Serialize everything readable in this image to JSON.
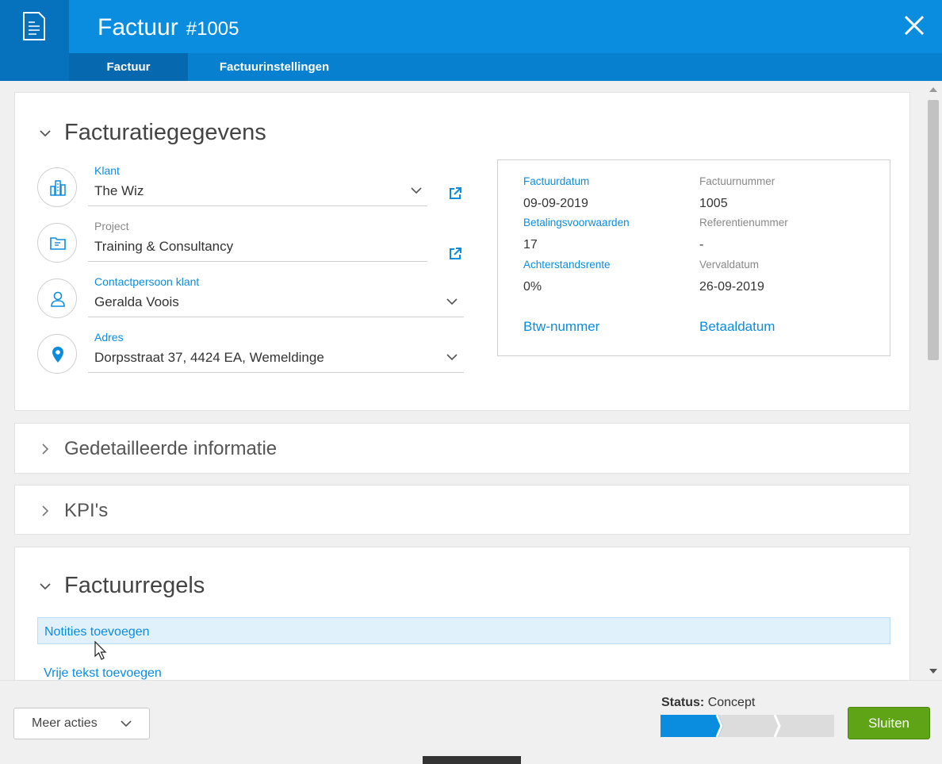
{
  "header": {
    "title": "Factuur",
    "number": "#1005",
    "tabs": [
      {
        "label": "Factuur",
        "active": true
      },
      {
        "label": "Factuurinstellingen",
        "active": false
      }
    ],
    "colors": {
      "header": "#0a8ddf",
      "tile": "#0672bd",
      "tab_active": "#0669b0"
    }
  },
  "facturatie": {
    "title": "Facturatiegegevens",
    "fields": [
      {
        "label": "Klant",
        "value": "The Wiz",
        "icon": "building-icon"
      },
      {
        "label": "Project",
        "value": "Training & Consultancy",
        "icon": "folder-icon"
      },
      {
        "label": "Contactpersoon klant",
        "value": "Geralda Voois",
        "icon": "person-icon"
      },
      {
        "label": "Adres",
        "value": "Dorpsstraat 37, 4424 EA, Wemeldinge",
        "icon": "location-pin-icon"
      }
    ],
    "info": {
      "factuurdatum_label": "Factuurdatum",
      "factuurdatum": "09-09-2019",
      "factuurnummer_label": "Factuurnummer",
      "factuurnummer": "1005",
      "betalingsvoorwaarden_label": "Betalingsvoorwaarden",
      "betalingsvoorwaarden": "17",
      "referentienummer_label": "Referentienummer",
      "referentienummer": "-",
      "achterstandsrente_label": "Achterstandsrente",
      "achterstandsrente": "0%",
      "vervaldatum_label": "Vervaldatum",
      "vervaldatum": "26-09-2019",
      "btw_link": "Btw-nummer",
      "betaaldatum_link": "Betaaldatum"
    }
  },
  "sections": {
    "gedetailleerd": "Gedetailleerde informatie",
    "kpis": "KPI's",
    "factuurregels": "Factuurregels"
  },
  "factuurregels": {
    "notes_link": "Notities toevoegen",
    "free_text_link": "Vrije tekst toevoegen"
  },
  "footer": {
    "meer_acties": "Meer acties",
    "status_label": "Status:",
    "status_value": "Concept",
    "status_step": 1,
    "status_steps_total": 3,
    "sluiten": "Sluiten",
    "colors": {
      "progress": "#0a8ddf",
      "sluiten": "#5fa316"
    }
  }
}
